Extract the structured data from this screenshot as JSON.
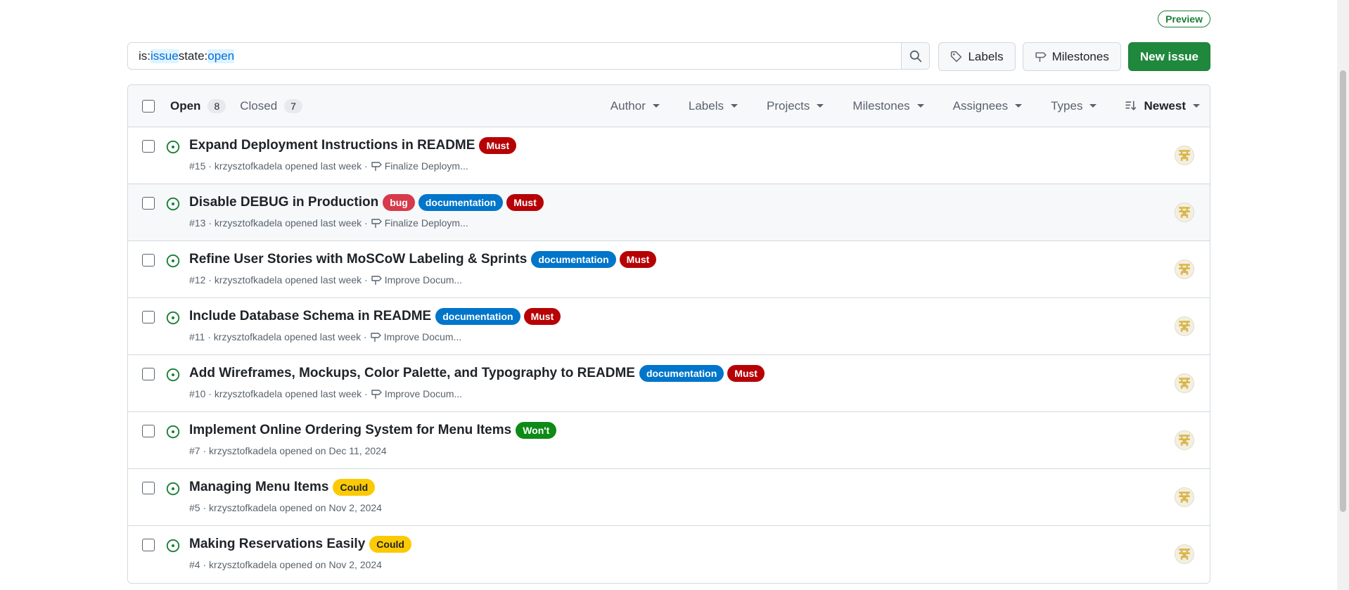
{
  "preview_badge": "Preview",
  "search": {
    "tokens": [
      {
        "key": "is:",
        "value": "issue"
      },
      {
        "key": " state:",
        "value": "open"
      }
    ]
  },
  "toolbar": {
    "labels_btn": "Labels",
    "milestones_btn": "Milestones",
    "new_issue_btn": "New issue"
  },
  "header": {
    "open_label": "Open",
    "open_count": "8",
    "closed_label": "Closed",
    "closed_count": "7",
    "filters": [
      "Author",
      "Labels",
      "Projects",
      "Milestones",
      "Assignees",
      "Types"
    ],
    "sort_label": "Newest"
  },
  "label_colors": {
    "Must": {
      "bg": "#b60205",
      "fg": "#ffffff"
    },
    "bug": {
      "bg": "#d73a4a",
      "fg": "#ffffff"
    },
    "documentation": {
      "bg": "#0075ca",
      "fg": "#ffffff"
    },
    "Won't": {
      "bg": "#0e8a16",
      "fg": "#ffffff"
    },
    "Could": {
      "bg": "#fbca04",
      "fg": "#1f2328"
    }
  },
  "issues": [
    {
      "title": "Expand Deployment Instructions in README",
      "labels": [
        "Must"
      ],
      "number": "#15",
      "author": "krzysztofkadela",
      "opened": "opened last week",
      "milestone": "Finalize Deploym..."
    },
    {
      "title": "Disable DEBUG in Production",
      "labels": [
        "bug",
        "documentation",
        "Must"
      ],
      "number": "#13",
      "author": "krzysztofkadela",
      "opened": "opened last week",
      "milestone": "Finalize Deploym..."
    },
    {
      "title": "Refine User Stories with MoSCoW Labeling & Sprints",
      "labels": [
        "documentation",
        "Must"
      ],
      "number": "#12",
      "author": "krzysztofkadela",
      "opened": "opened last week",
      "milestone": "Improve Docum..."
    },
    {
      "title": "Include Database Schema in README",
      "labels": [
        "documentation",
        "Must"
      ],
      "number": "#11",
      "author": "krzysztofkadela",
      "opened": "opened last week",
      "milestone": "Improve Docum..."
    },
    {
      "title": "Add Wireframes, Mockups, Color Palette, and Typography to README",
      "labels": [
        "documentation",
        "Must"
      ],
      "number": "#10",
      "author": "krzysztofkadela",
      "opened": "opened last week",
      "milestone": "Improve Docum..."
    },
    {
      "title": "Implement Online Ordering System for Menu Items",
      "labels": [
        "Won't"
      ],
      "number": "#7",
      "author": "krzysztofkadela",
      "opened": "opened on Dec 11, 2024",
      "milestone": ""
    },
    {
      "title": "Managing Menu Items",
      "labels": [
        "Could"
      ],
      "number": "#5",
      "author": "krzysztofkadela",
      "opened": "opened on Nov 2, 2024",
      "milestone": ""
    },
    {
      "title": "Making Reservations Easily",
      "labels": [
        "Could"
      ],
      "number": "#4",
      "author": "krzysztofkadela",
      "opened": "opened on Nov 2, 2024",
      "milestone": ""
    }
  ]
}
